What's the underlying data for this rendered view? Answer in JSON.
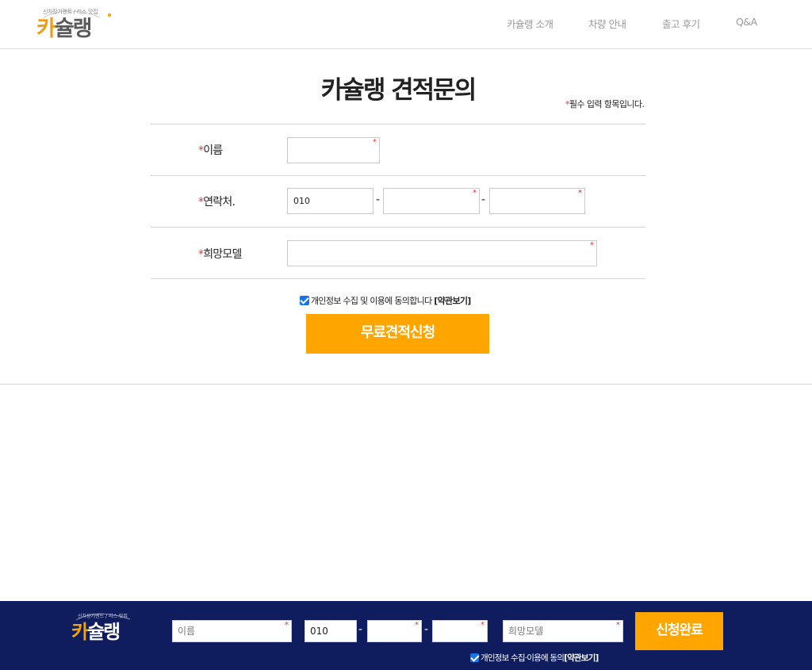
{
  "brand": {
    "tagline": "신차장기렌트 / 리스 맛집",
    "name_first": "카",
    "name_rest": "슐랭"
  },
  "nav": {
    "items": [
      "카슐랭 소개",
      "차량 안내",
      "출고 후기",
      "Q&A"
    ]
  },
  "form": {
    "title": "카슐랭 견적문의",
    "required_note": "필수 입력 항목입니다.",
    "required_mark": "*",
    "name_label": "이름",
    "phone_label": "연락처.",
    "phone_prefix_value": "010",
    "phone_dash": "-",
    "model_label": "희망모델",
    "agree_text": "개인정보 수집 및 이용에 동의합니다",
    "agree_link": "[약관보기]",
    "agree_checked": true,
    "submit_label": "무료견적신청"
  },
  "footer": {
    "name_placeholder": "이름",
    "phone_prefix_value": "010",
    "phone_dash": "-",
    "model_placeholder": "희망모델",
    "submit_label": "신청완료",
    "agree_text": "개인정보 수집·이용에 동의",
    "agree_link": "[약관보기]",
    "required_mark": "*"
  },
  "colors": {
    "accent": "#ffa500",
    "footer_bg": "#0f1d5e",
    "required": "#e53935",
    "checkbox": "#1a73e8"
  }
}
